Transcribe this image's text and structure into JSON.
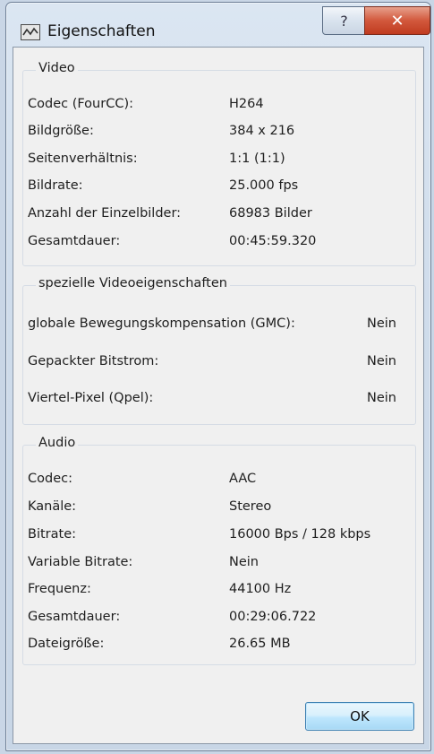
{
  "window": {
    "title": "Eigenschaften",
    "help_label": "?",
    "close_label": "✕"
  },
  "video": {
    "title": "Video",
    "rows": [
      {
        "label": "Codec (FourCC):",
        "value": "H264"
      },
      {
        "label": "Bildgröße:",
        "value": "384 x 216"
      },
      {
        "label": "Seitenverhältnis:",
        "value": "1:1 (1:1)"
      },
      {
        "label": "Bildrate:",
        "value": "25.000 fps"
      },
      {
        "label": "Anzahl der Einzelbilder:",
        "value": "68983 Bilder"
      },
      {
        "label": "Gesamtdauer:",
        "value": "00:45:59.320"
      }
    ]
  },
  "special": {
    "title": "spezielle Videoeigenschaften",
    "rows": [
      {
        "label": "globale Bewegungskompensation (GMC):",
        "value": "Nein"
      },
      {
        "label": "Gepackter Bitstrom:",
        "value": "Nein"
      },
      {
        "label": "Viertel-Pixel (Qpel):",
        "value": "Nein"
      }
    ]
  },
  "audio": {
    "title": "Audio",
    "rows": [
      {
        "label": "Codec:",
        "value": "AAC"
      },
      {
        "label": "Kanäle:",
        "value": "Stereo"
      },
      {
        "label": "Bitrate:",
        "value": "16000 Bps / 128 kbps"
      },
      {
        "label": "Variable Bitrate:",
        "value": "Nein"
      },
      {
        "label": "Frequenz:",
        "value": "44100 Hz"
      },
      {
        "label": "Gesamtdauer:",
        "value": "00:29:06.722"
      },
      {
        "label": "Dateigröße:",
        "value": "26.65 MB"
      }
    ]
  },
  "buttons": {
    "ok_label": "OK"
  }
}
